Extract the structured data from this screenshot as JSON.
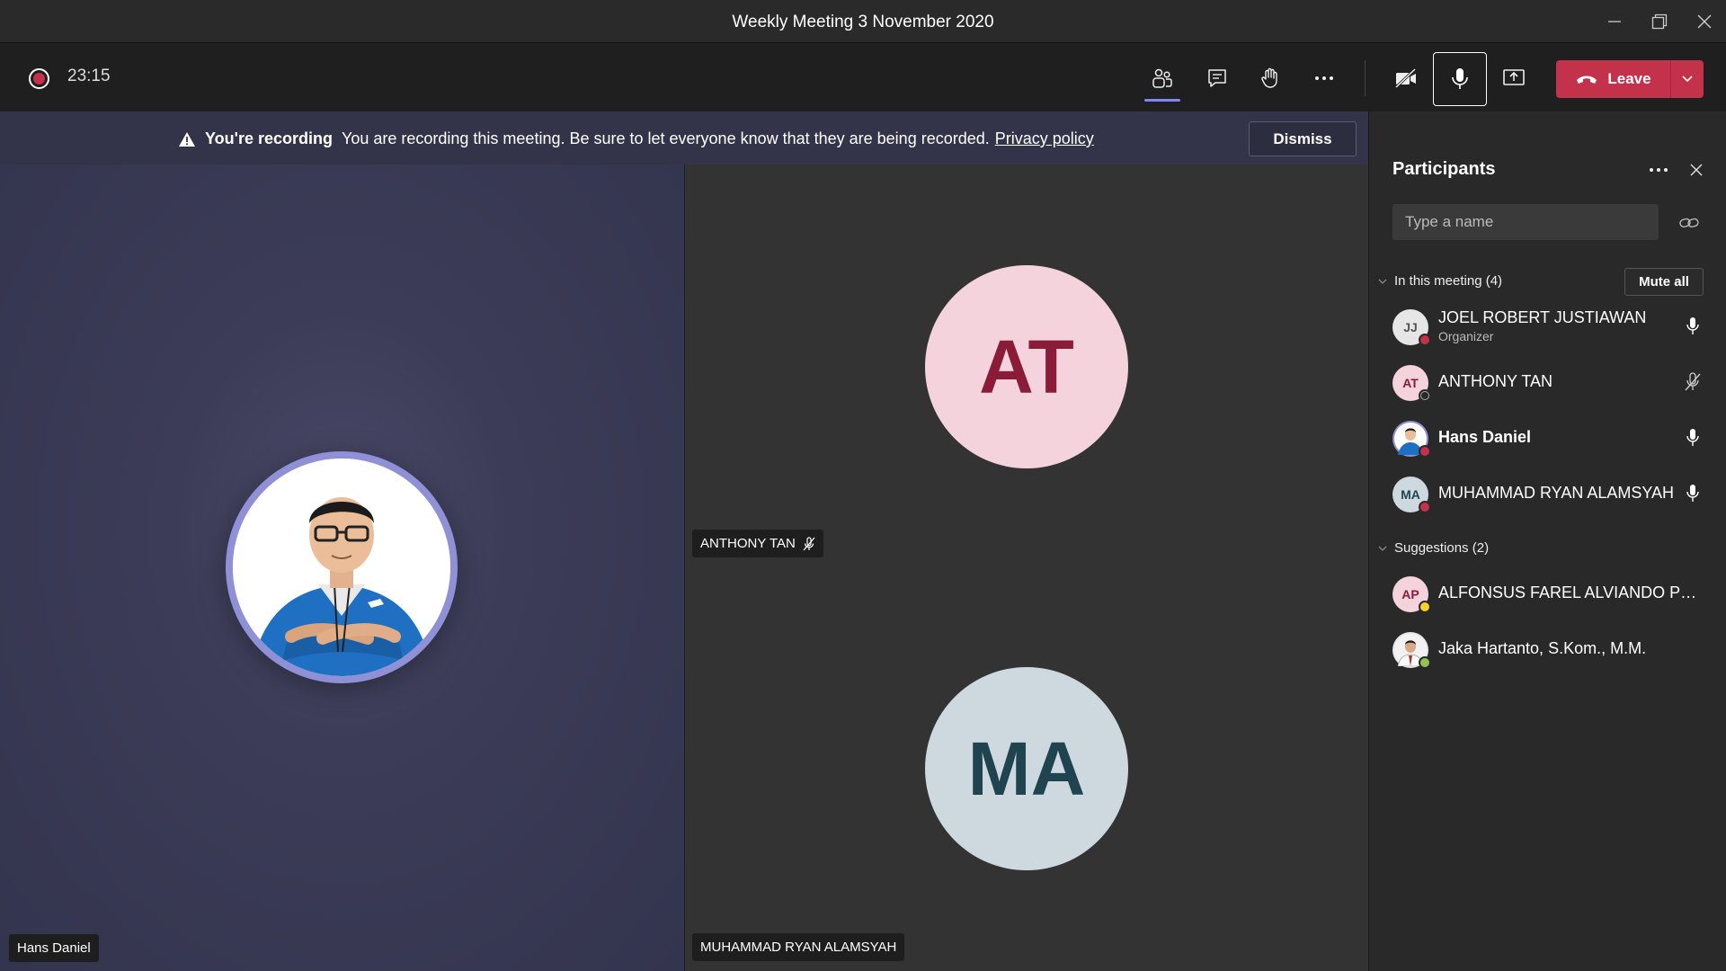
{
  "window": {
    "title": "Weekly Meeting 3 November 2020"
  },
  "toolbar": {
    "timer": "23:15",
    "leave_label": "Leave"
  },
  "banner": {
    "heading": "You're recording",
    "message": "You are recording this meeting. Be sure to let everyone know that they are being recorded.",
    "link": "Privacy policy",
    "dismiss_label": "Dismiss"
  },
  "stage": {
    "tiles": [
      {
        "name": "Hans Daniel"
      },
      {
        "name": "ANTHONY TAN",
        "initials": "AT",
        "avatar_bg": "#f4d3dc",
        "initials_color": "#8a1c3a",
        "muted": true
      },
      {
        "name": "MUHAMMAD RYAN ALAMSYAH",
        "initials": "MA",
        "avatar_bg": "#cdd8df",
        "initials_color": "#1f4450"
      }
    ]
  },
  "participants": {
    "title": "Participants",
    "search_placeholder": "Type a name",
    "in_meeting_label": "In this meeting (4)",
    "mute_all_label": "Mute all",
    "in_meeting": [
      {
        "initials": "JJ",
        "name": "JOEL ROBERT JUSTIAWAN",
        "role": "Organizer",
        "mic": "on",
        "status": "busy",
        "avatar_bg": "#e6e6e6",
        "initials_color": "#555"
      },
      {
        "initials": "AT",
        "name": "ANTHONY TAN",
        "mic": "muted",
        "status": "offline",
        "avatar_bg": "#f4d3dc",
        "initials_color": "#8a1c3a"
      },
      {
        "initials": "",
        "name": "Hans Daniel",
        "mic": "on",
        "status": "busy"
      },
      {
        "initials": "MA",
        "name": "MUHAMMAD RYAN ALAMSYAH",
        "mic": "on",
        "status": "busy",
        "avatar_bg": "#cdd8df",
        "initials_color": "#1f4450"
      }
    ],
    "suggestions_label": "Suggestions (2)",
    "suggestions": [
      {
        "initials": "AP",
        "name": "ALFONSUS FAREL ALVIANDO PRATA...",
        "status": "away",
        "avatar_bg": "#f4d3dc",
        "initials_color": "#8a1c3a"
      },
      {
        "initials": "",
        "name": "Jaka Hartanto, S.Kom., M.M.",
        "status": "available"
      }
    ]
  },
  "colors": {
    "accent": "#7f85f5",
    "leave": "#c4314b",
    "busy": "#c4314b",
    "away": "#f8d22a",
    "available": "#92c353",
    "banner_bg": "#33344a"
  }
}
